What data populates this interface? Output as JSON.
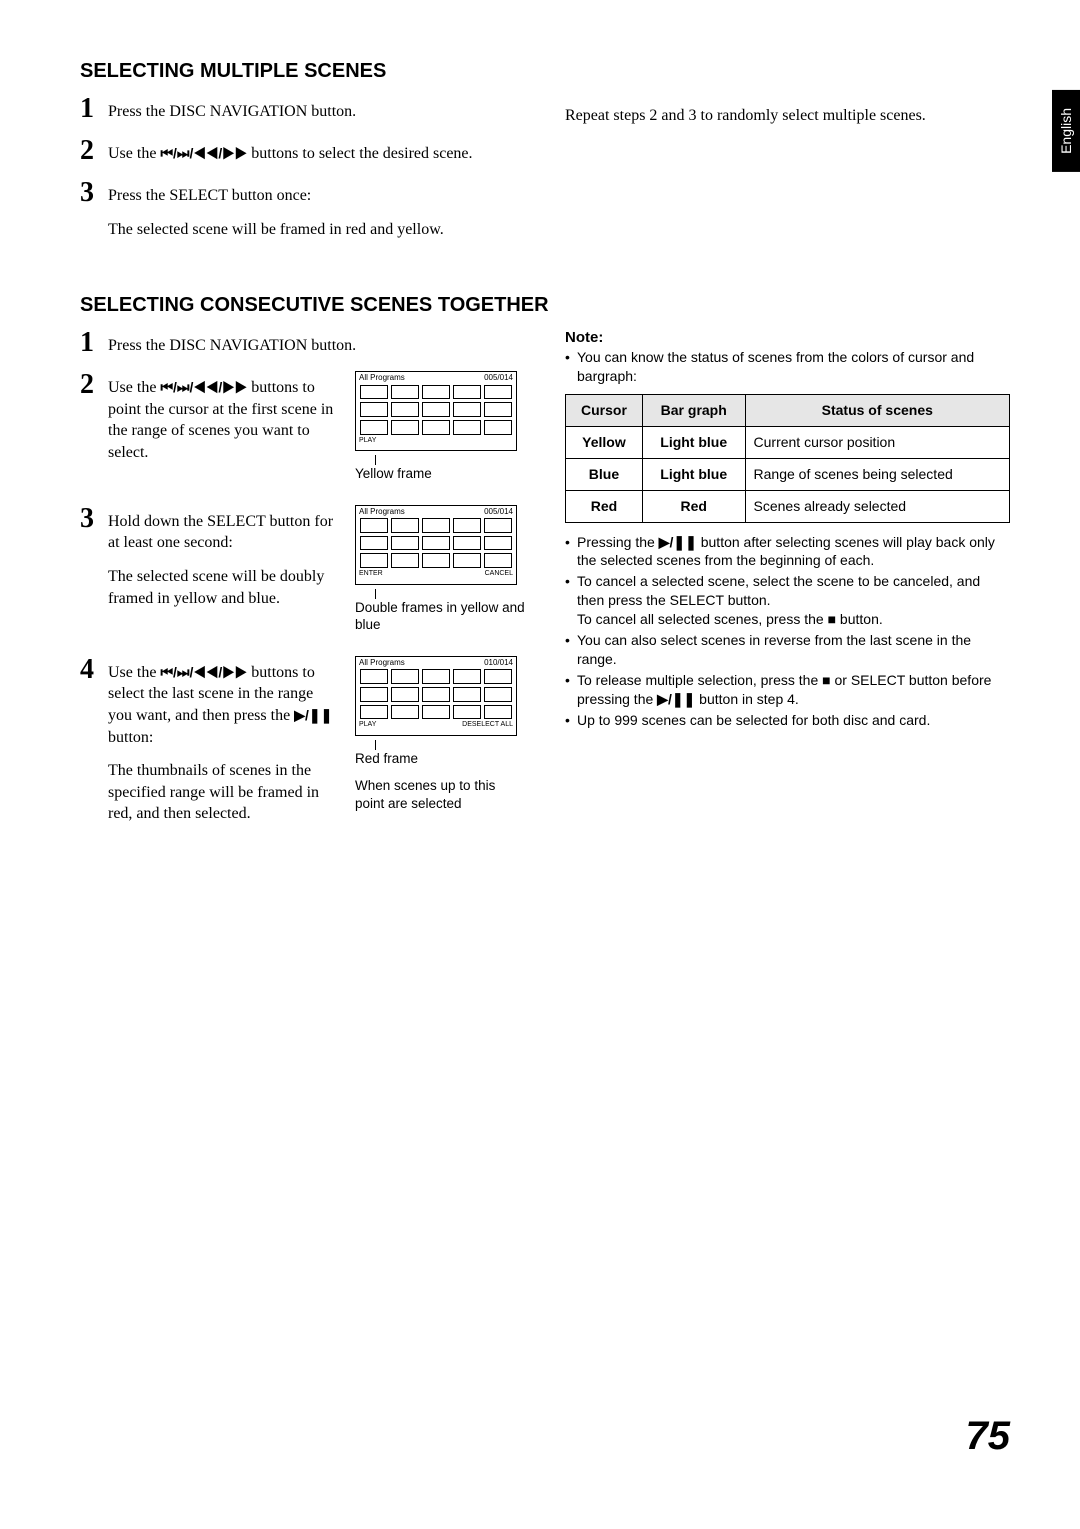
{
  "language_tab": "English",
  "page_number": "75",
  "section1": {
    "heading": "SELECTING MULTIPLE SCENES",
    "step1": {
      "num": "1",
      "text": "Press the DISC NAVIGATION button."
    },
    "step2": {
      "num": "2",
      "pre": "Use the ",
      "icons": "⏮/⏭/◀◀/▶▶",
      "post": " buttons to select the desired scene."
    },
    "step3": {
      "num": "3",
      "text": "Press the SELECT button once:",
      "after": "The selected scene will be framed in red and yellow."
    },
    "right_text": "Repeat steps 2 and 3 to randomly select multiple scenes."
  },
  "section2": {
    "heading": "SELECTING CONSECUTIVE SCENES TOGETHER",
    "step1": {
      "num": "1",
      "text": "Press the DISC NAVIGATION button."
    },
    "step2": {
      "num": "2",
      "pre": "Use the ",
      "icons": "⏮/⏭/◀◀/▶▶",
      "post": " buttons to point the cursor at the first scene in the range of scenes you want to select."
    },
    "step3": {
      "num": "3",
      "text": "Hold down the SELECT button for at least one second:",
      "after": "The selected scene will be doubly framed in yellow and blue."
    },
    "step4": {
      "num": "4",
      "pre": "Use the ",
      "icons": "⏮/⏭/◀◀/▶▶",
      "post": " buttons to select the last scene in the range you want, and then press the ",
      "play_icon": "▶/❚❚",
      "post2": " button:",
      "after": "The thumbnails of scenes in the specified range will be framed in red, and then selected."
    },
    "gfx1": {
      "title_l": "All Programs",
      "title_r": "005/014",
      "footer_l": "PLAY",
      "footer_r": "",
      "caption": "Yellow frame"
    },
    "gfx2": {
      "title_l": "All Programs",
      "title_r": "005/014",
      "footer_l": "ENTER",
      "footer_m": "CANCEL",
      "caption": "Double frames in yellow and blue"
    },
    "gfx3": {
      "title_l": "All Programs",
      "title_r": "010/014",
      "footer_l": "PLAY",
      "footer_m": "DESELECT ALL",
      "caption1": "Red frame",
      "caption2": "When scenes up to this point are selected"
    }
  },
  "notes": {
    "head": "Note:",
    "b1": "You can know the status of scenes from the colors of cursor and bargraph:",
    "table": {
      "h1": "Cursor",
      "h2": "Bar graph",
      "h3": "Status of scenes",
      "r1c1": "Yellow",
      "r1c2": "Light blue",
      "r1c3": "Current cursor position",
      "r2c1": "Blue",
      "r2c2": "Light blue",
      "r2c3": "Range of scenes being selected",
      "r3c1": "Red",
      "r3c2": "Red",
      "r3c3": "Scenes already selected"
    },
    "b2_pre": "Pressing the ",
    "b2_icon": "▶/❚❚",
    "b2_post": " button after selecting scenes will play back only the selected scenes from the beginning of each.",
    "b3_l1": "To cancel a selected scene, select the scene to be canceled, and then press the SELECT button.",
    "b3_l2_pre": "To cancel all selected scenes, press the ",
    "b3_l2_icon": "■",
    "b3_l2_post": " button.",
    "b4": "You can also select scenes in reverse from the last scene in the range.",
    "b5_pre": "To release multiple selection, press the ",
    "b5_icon1": "■",
    "b5_mid": " or SELECT button before pressing the ",
    "b5_icon2": "▶/❚❚",
    "b5_post": " button in step 4.",
    "b6": "Up to 999 scenes can be selected for both disc and card."
  }
}
